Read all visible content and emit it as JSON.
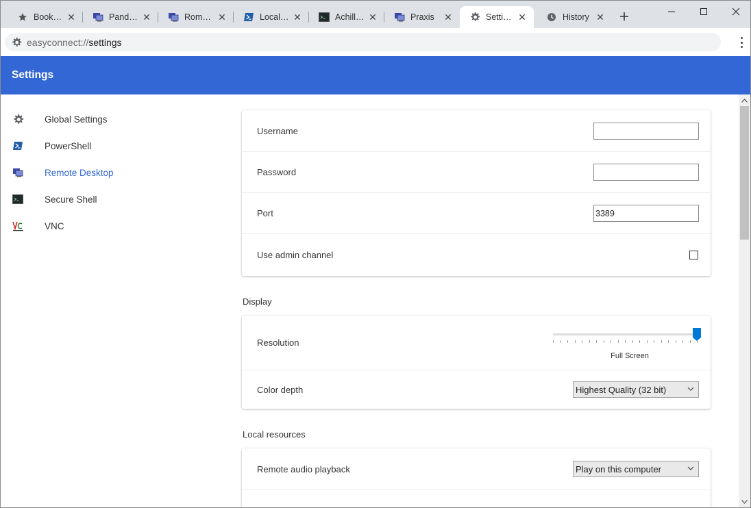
{
  "tabs": [
    {
      "label": "Book…",
      "icon": "star-icon"
    },
    {
      "label": "Pand…",
      "icon": "remote-desktop-icon"
    },
    {
      "label": "Rom…",
      "icon": "remote-desktop-icon"
    },
    {
      "label": "Local…",
      "icon": "powershell-icon"
    },
    {
      "label": "Achill…",
      "icon": "terminal-icon"
    },
    {
      "label": "Praxis",
      "icon": "remote-desktop-icon"
    },
    {
      "label": "Setti…",
      "icon": "gear-icon",
      "active": true
    },
    {
      "label": "History",
      "icon": "clock-icon"
    }
  ],
  "address": {
    "scheme": "easyconnect://",
    "host": "settings"
  },
  "header": {
    "title": "Settings"
  },
  "sidebar": {
    "items": [
      {
        "label": "Global Settings",
        "icon": "gear-icon"
      },
      {
        "label": "PowerShell",
        "icon": "powershell-icon"
      },
      {
        "label": "Remote Desktop",
        "icon": "remote-desktop-icon",
        "active": true
      },
      {
        "label": "Secure Shell",
        "icon": "terminal-icon"
      },
      {
        "label": "VNC",
        "icon": "vnc-icon"
      }
    ]
  },
  "connection": {
    "username_label": "Username",
    "username_value": "",
    "password_label": "Password",
    "password_value": "",
    "port_label": "Port",
    "port_value": "3389",
    "admin_label": "Use admin channel",
    "admin_checked": false
  },
  "display": {
    "section_title": "Display",
    "resolution_label": "Resolution",
    "resolution_value_label": "Full Screen",
    "resolution_level": 1.0,
    "color_depth_label": "Color depth",
    "color_depth_value": "Highest Quality (32 bit)"
  },
  "local_resources": {
    "section_title": "Local resources",
    "audio_label": "Remote audio playback",
    "audio_value": "Play on this computer"
  },
  "colors": {
    "accent": "#3367d6",
    "slider_thumb": "#0078d7"
  }
}
